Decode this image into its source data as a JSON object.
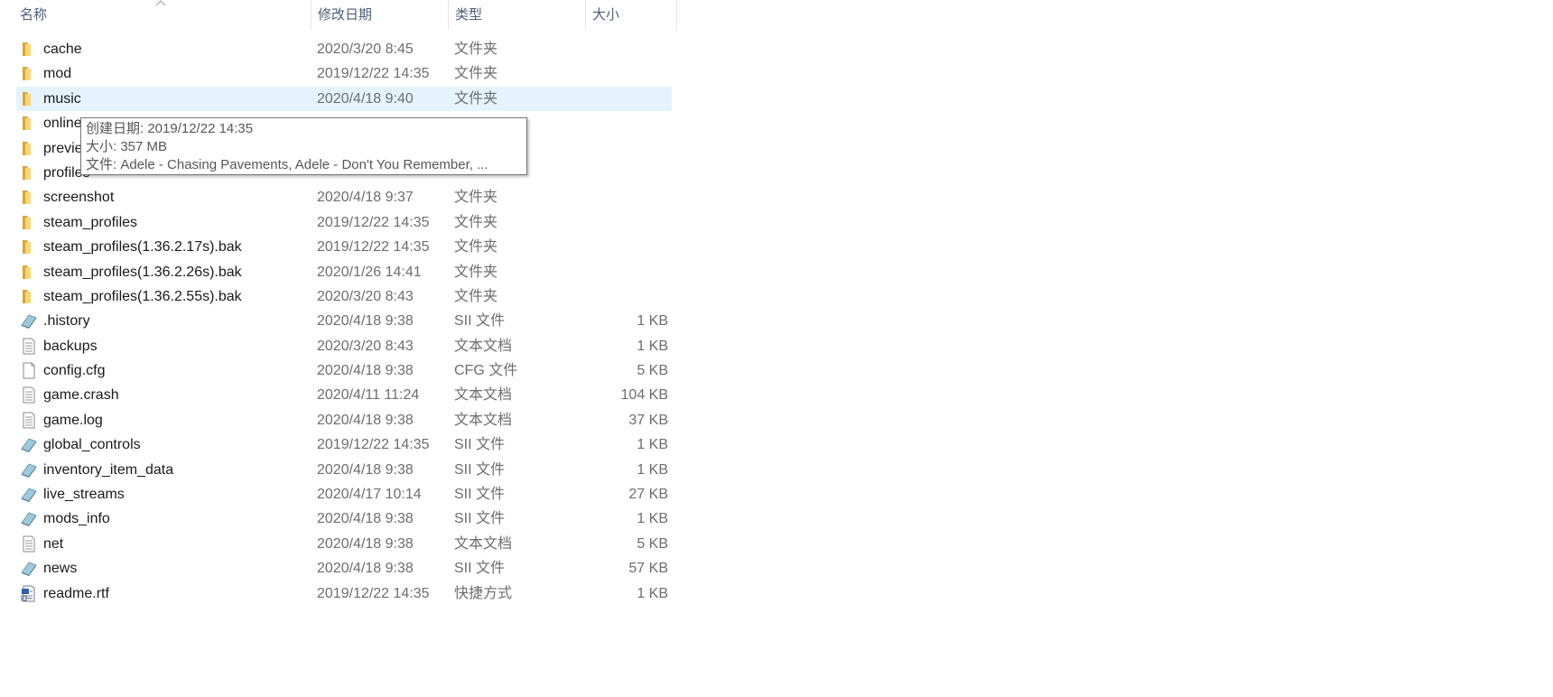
{
  "columns": {
    "name": "名称",
    "date": "修改日期",
    "type": "类型",
    "size": "大小"
  },
  "files": [
    {
      "icon": "folder-icon",
      "name": "cache",
      "date": "2020/3/20 8:45",
      "type": "文件夹",
      "size": ""
    },
    {
      "icon": "folder-icon",
      "name": "mod",
      "date": "2019/12/22 14:35",
      "type": "文件夹",
      "size": ""
    },
    {
      "icon": "folder-icon",
      "name": "music",
      "date": "2020/4/18 9:40",
      "type": "文件夹",
      "size": "",
      "selected": true
    },
    {
      "icon": "folder-icon",
      "name": "online",
      "date": "",
      "type": "",
      "size": ""
    },
    {
      "icon": "folder-icon",
      "name": "previe",
      "date": "",
      "type": "",
      "size": ""
    },
    {
      "icon": "folder-icon",
      "name": "profiles",
      "date": "",
      "type": "",
      "size": ""
    },
    {
      "icon": "folder-icon",
      "name": "screenshot",
      "date": "2020/4/18 9:37",
      "type": "文件夹",
      "size": ""
    },
    {
      "icon": "folder-icon",
      "name": "steam_profiles",
      "date": "2019/12/22 14:35",
      "type": "文件夹",
      "size": ""
    },
    {
      "icon": "folder-icon",
      "name": "steam_profiles(1.36.2.17s).bak",
      "date": "2019/12/22 14:35",
      "type": "文件夹",
      "size": ""
    },
    {
      "icon": "folder-icon",
      "name": "steam_profiles(1.36.2.26s).bak",
      "date": "2020/1/26 14:41",
      "type": "文件夹",
      "size": ""
    },
    {
      "icon": "folder-icon",
      "name": "steam_profiles(1.36.2.55s).bak",
      "date": "2020/3/20 8:43",
      "type": "文件夹",
      "size": ""
    },
    {
      "icon": "sii-file-icon",
      "name": ".history",
      "date": "2020/4/18 9:38",
      "type": "SII 文件",
      "size": "1 KB"
    },
    {
      "icon": "text-file-icon",
      "name": "backups",
      "date": "2020/3/20 8:43",
      "type": "文本文档",
      "size": "1 KB"
    },
    {
      "icon": "blank-file-icon",
      "name": "config.cfg",
      "date": "2020/4/18 9:38",
      "type": "CFG 文件",
      "size": "5 KB"
    },
    {
      "icon": "text-file-icon",
      "name": "game.crash",
      "date": "2020/4/11 11:24",
      "type": "文本文档",
      "size": "104 KB"
    },
    {
      "icon": "text-file-icon",
      "name": "game.log",
      "date": "2020/4/18 9:38",
      "type": "文本文档",
      "size": "37 KB"
    },
    {
      "icon": "sii-file-icon",
      "name": "global_controls",
      "date": "2019/12/22 14:35",
      "type": "SII 文件",
      "size": "1 KB"
    },
    {
      "icon": "sii-file-icon",
      "name": "inventory_item_data",
      "date": "2020/4/18 9:38",
      "type": "SII 文件",
      "size": "1 KB"
    },
    {
      "icon": "sii-file-icon",
      "name": "live_streams",
      "date": "2020/4/17 10:14",
      "type": "SII 文件",
      "size": "27 KB"
    },
    {
      "icon": "sii-file-icon",
      "name": "mods_info",
      "date": "2020/4/18 9:38",
      "type": "SII 文件",
      "size": "1 KB"
    },
    {
      "icon": "text-file-icon",
      "name": "net",
      "date": "2020/4/18 9:38",
      "type": "文本文档",
      "size": "5 KB"
    },
    {
      "icon": "sii-file-icon",
      "name": "news",
      "date": "2020/4/18 9:38",
      "type": "SII 文件",
      "size": "57 KB"
    },
    {
      "icon": "rtf-shortcut-icon",
      "name": "readme.rtf",
      "date": "2019/12/22 14:35",
      "type": "快捷方式",
      "size": "1 KB"
    }
  ],
  "tooltip": {
    "created": "创建日期: 2019/12/22 14:35",
    "size": "大小: 357 MB",
    "files": "文件: Adele - Chasing Pavements, Adele - Don't You Remember, ..."
  },
  "colors": {
    "selection": "#e5f3ff",
    "header_text": "#4c607a",
    "folder_yellow": "#f8d775"
  }
}
